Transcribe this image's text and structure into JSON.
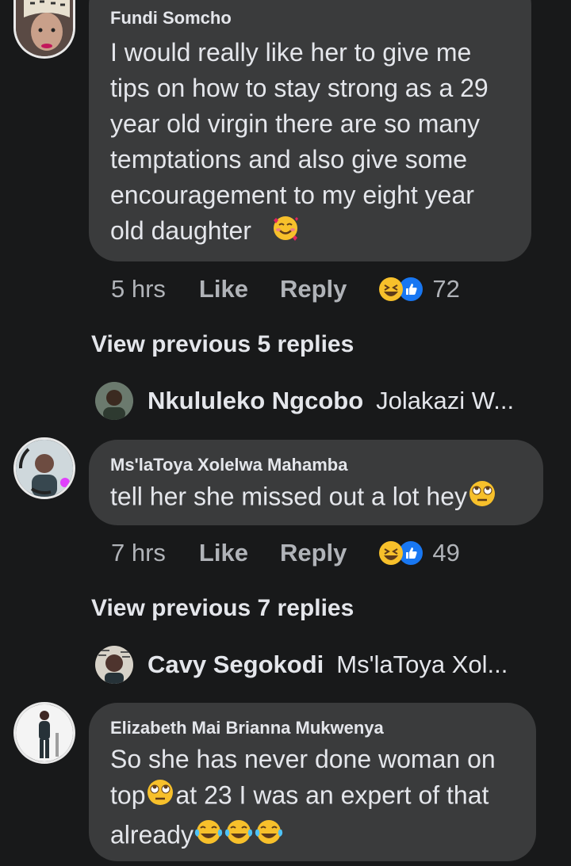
{
  "comments": [
    {
      "author": "Fundi Somcho",
      "lines": [
        "I would really like her to give me",
        "tips on how to stay strong as a 29",
        "year old virgin there are so many",
        "temptations and also give some",
        "encouragement to my eight year",
        "old daughter"
      ],
      "emoji": "smiling-face-with-hearts",
      "time": "5 hrs",
      "like_label": "Like",
      "reply_label": "Reply",
      "reaction_count": "72",
      "view_previous": "View previous 5 replies",
      "latest_reply": {
        "name": "Nkululeko Ngcobo",
        "preview": "Jolakazi W..."
      }
    },
    {
      "author": "Ms'laToya Xolelwa Mahamba",
      "lines": [
        "tell her she missed out a lot hey"
      ],
      "emoji": "face-with-rolling-eyes",
      "time": "7 hrs",
      "like_label": "Like",
      "reply_label": "Reply",
      "reaction_count": "49",
      "view_previous": "View previous 7 replies",
      "latest_reply": {
        "name": "Cavy Segokodi",
        "preview": "Ms'laToya Xol..."
      }
    },
    {
      "author": "Elizabeth Mai Brianna Mukwenya",
      "lines": [
        "So she has never done woman on",
        "top",
        "at 23 I was an expert of that",
        "already"
      ],
      "emoji": "face-with-tears-of-joy"
    }
  ],
  "colors": {
    "background": "#18191a",
    "bubble": "#3a3b3c",
    "text": "#e4e6eb",
    "meta": "#b0b3b8",
    "like_blue": "#1877f2",
    "emoji_yellow": "#f7c02b"
  }
}
